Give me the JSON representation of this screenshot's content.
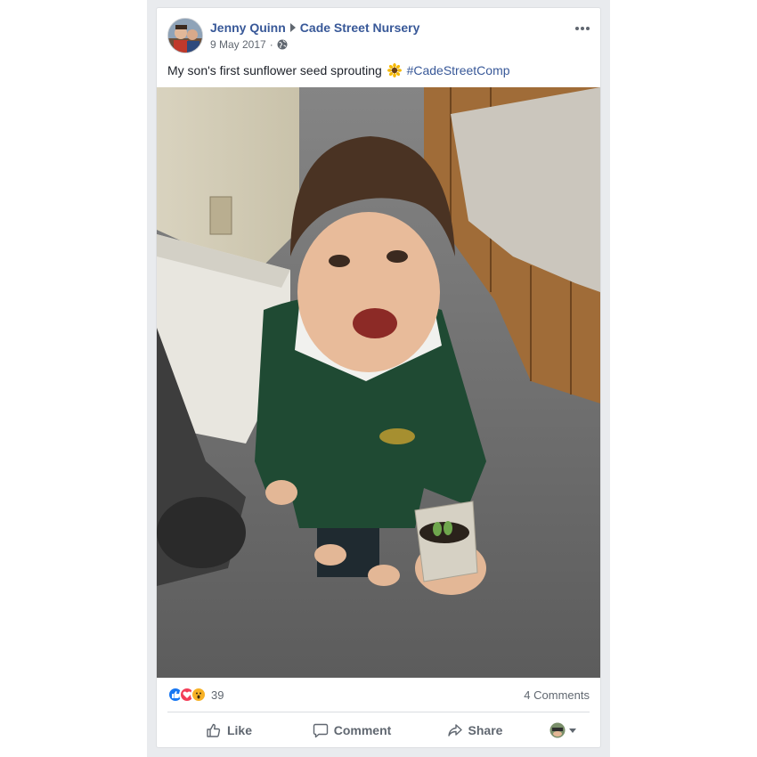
{
  "post": {
    "author": "Jenny Quinn",
    "group": "Cade Street Nursery",
    "date": "9 May 2017",
    "date_separator": "·",
    "caption_text": "My son's first sunflower seed sprouting",
    "hashtag": "#CadeStreetComp"
  },
  "engagement": {
    "reaction_count": "39",
    "comments_label": "4 Comments",
    "reactions": [
      "like",
      "love",
      "wow"
    ]
  },
  "actions": {
    "like_label": "Like",
    "comment_label": "Comment",
    "share_label": "Share"
  },
  "colors": {
    "link_blue": "#385898",
    "meta_gray": "#606770",
    "like_blue": "#1877f2",
    "love_red": "#f33e58",
    "wow_yellow": "#f7b125"
  },
  "icons": [
    "globe-icon",
    "more-options-icon",
    "sunflower-emoji",
    "like-icon",
    "comment-icon",
    "share-icon"
  ]
}
